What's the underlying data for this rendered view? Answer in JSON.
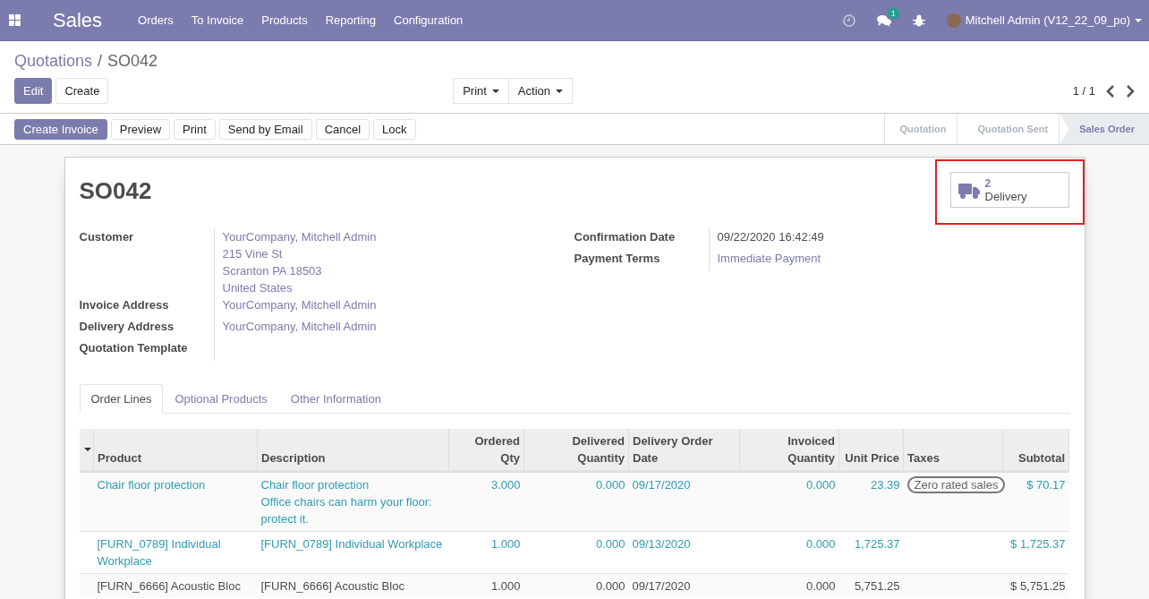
{
  "navbar": {
    "app": "Sales",
    "menu": [
      "Orders",
      "To Invoice",
      "Products",
      "Reporting",
      "Configuration"
    ],
    "messages_count": "1",
    "user": "Mitchell Admin (V12_22_09_po)"
  },
  "breadcrumb": {
    "parent": "Quotations",
    "separator": "/",
    "current": "SO042"
  },
  "buttons": [
    {
      "label": "Edit",
      "primary": true
    },
    {
      "label": "Create",
      "primary": false
    }
  ],
  "dropdowns": [
    "Print",
    "Action"
  ],
  "pager": "1 / 1",
  "actions": [
    {
      "label": "Create Invoice",
      "primary": true
    },
    {
      "label": "Preview",
      "primary": false
    },
    {
      "label": "Print",
      "primary": false
    },
    {
      "label": "Send by Email",
      "primary": false
    },
    {
      "label": "Cancel",
      "primary": false
    },
    {
      "label": "Lock",
      "primary": false
    }
  ],
  "stages": [
    {
      "label": "Quotation",
      "selected": false
    },
    {
      "label": "Quotation Sent",
      "selected": false
    },
    {
      "label": "Sales Order",
      "selected": true
    }
  ],
  "smart_button": {
    "count": "2",
    "label": "Delivery"
  },
  "title": "SO042",
  "fields_left": [
    {
      "label": "Customer",
      "lines": [
        "YourCompany, Mitchell Admin",
        "215 Vine St",
        "Scranton PA 18503",
        "United States"
      ]
    },
    {
      "label": "Invoice Address",
      "lines": [
        "YourCompany, Mitchell Admin"
      ]
    },
    {
      "label": "Delivery Address",
      "lines": [
        "YourCompany, Mitchell Admin"
      ]
    },
    {
      "label": "Quotation Template"
    }
  ],
  "fields_right": [
    {
      "label": "Confirmation Date",
      "lines": [
        "09/22/2020 16:42:49"
      ],
      "kind": "text"
    },
    {
      "label": "Payment Terms",
      "lines": [
        "Immediate Payment"
      ],
      "kind": "link"
    }
  ],
  "tabs": [
    {
      "label": "Order Lines",
      "selected": true
    },
    {
      "label": "Optional Products",
      "selected": false
    },
    {
      "label": "Other Information",
      "selected": false
    }
  ],
  "table": {
    "columns": [
      "Product",
      "Description",
      "Ordered Qty",
      "Delivered Quantity",
      "Delivery Order Date",
      "Invoiced Quantity",
      "Unit Price",
      "Taxes",
      "Subtotal"
    ],
    "rows": [
      {
        "kind": "info",
        "product": "Chair floor protection",
        "description": [
          "Chair floor protection",
          "Office chairs can harm your floor: protect it."
        ],
        "ordered_qty": "3.000",
        "delivered_quantity": "0.000",
        "delivery_order_date": "09/17/2020",
        "invoiced_quantity": "0.000",
        "unit_price": "23.39",
        "taxes": [
          "Zero rated sales"
        ],
        "subtotal": "$ 70.17"
      },
      {
        "kind": "info",
        "product": "[FURN_0789] Individual Workplace",
        "description": [
          "[FURN_0789] Individual Workplace"
        ],
        "ordered_qty": "1.000",
        "delivered_quantity": "0.000",
        "delivery_order_date": "09/13/2020",
        "invoiced_quantity": "0.000",
        "unit_price": "1,725.37",
        "taxes": [],
        "subtotal": "$ 1,725.37"
      },
      {
        "kind": "normal",
        "product": "[FURN_6666] Acoustic Bloc",
        "description": [
          "[FURN_6666] Acoustic Bloc"
        ],
        "ordered_qty": "1.000",
        "delivered_quantity": "0.000",
        "delivery_order_date": "09/17/2020",
        "invoiced_quantity": "0.000",
        "unit_price": "5,751.25",
        "taxes": [],
        "subtotal": "$ 5,751.25"
      }
    ]
  }
}
